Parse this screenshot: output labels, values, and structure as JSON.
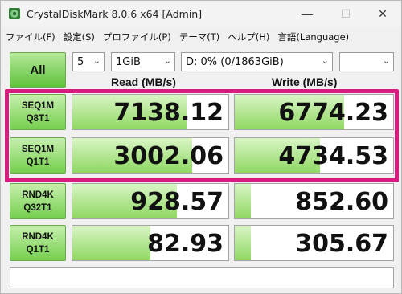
{
  "window": {
    "title": "CrystalDiskMark 8.0.6 x64 [Admin]",
    "minimize": "—",
    "maximize": "☐",
    "close": "✕"
  },
  "menu": [
    "ファイル(F)",
    "設定(S)",
    "プロファイル(P)",
    "テーマ(T)",
    "ヘルプ(H)",
    "言語(Language)"
  ],
  "controls": {
    "all_label": "All",
    "count": "5",
    "size": "1GiB",
    "drive": "D: 0% (0/1863GiB)",
    "unit": ""
  },
  "columns": {
    "read": "Read (MB/s)",
    "write": "Write (MB/s)"
  },
  "rows": [
    {
      "line1": "SEQ1M",
      "line2": "Q8T1",
      "read": "7138.12",
      "write": "6774.23",
      "read_fill": 0.73,
      "write_fill": 0.69
    },
    {
      "line1": "SEQ1M",
      "line2": "Q1T1",
      "read": "3002.06",
      "write": "4734.53",
      "read_fill": 0.77,
      "write_fill": 0.54
    },
    {
      "line1": "RND4K",
      "line2": "Q32T1",
      "read": "928.57",
      "write": "852.60",
      "read_fill": 0.67,
      "write_fill": 0.1
    },
    {
      "line1": "RND4K",
      "line2": "Q1T1",
      "read": "82.93",
      "write": "305.67",
      "read_fill": 0.5,
      "write_fill": 0.1
    }
  ],
  "colors": {
    "accent_green": "#75cf4e",
    "highlight": "#d81b7f"
  },
  "icons": {
    "app": "crystaldiskmark-app-icon",
    "dropdown": "chevron-down-icon"
  }
}
